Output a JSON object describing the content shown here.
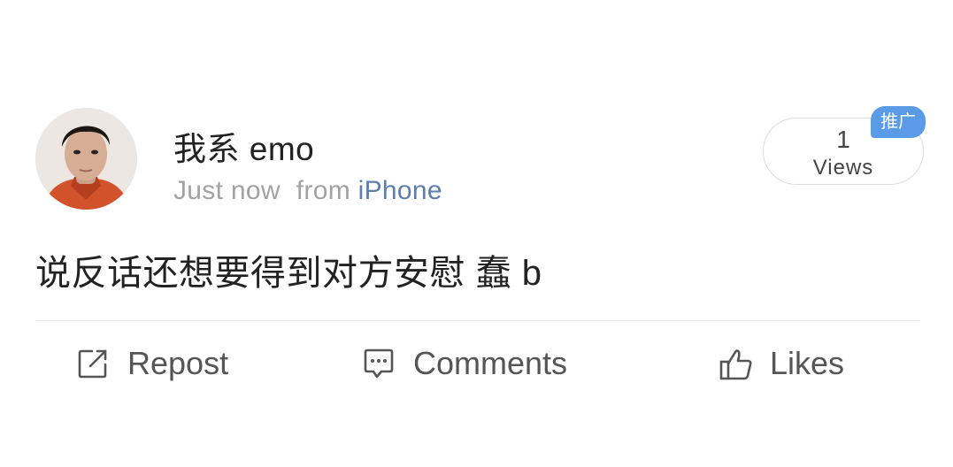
{
  "post": {
    "username": "我系 emo",
    "time": "Just now",
    "from_label": "from",
    "source": "iPhone",
    "views": {
      "count": "1",
      "label": "Views"
    },
    "promo_badge": "推广",
    "text": "说反话还想要得到对方安慰 蠢 b"
  },
  "actions": {
    "repost": "Repost",
    "comments": "Comments",
    "likes": "Likes"
  },
  "colors": {
    "source_link": "#5b80ad",
    "promo_badge": "#5a9be8"
  },
  "icons": {
    "repost": "edit-square-icon",
    "comments": "comment-bubble-icon",
    "likes": "thumbs-up-icon"
  }
}
